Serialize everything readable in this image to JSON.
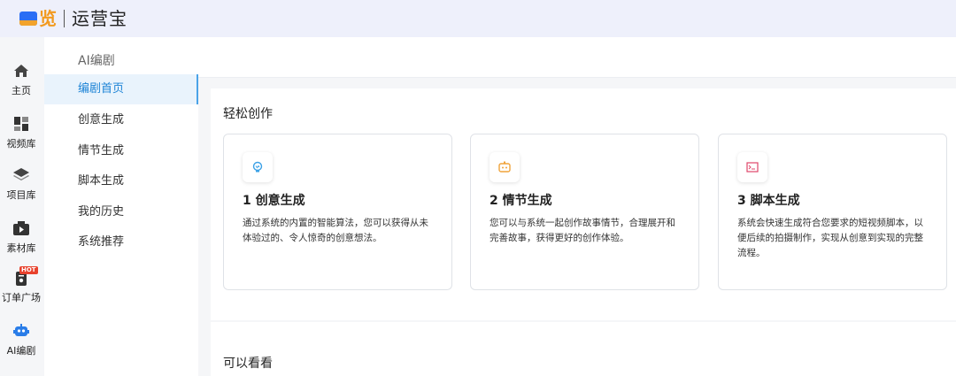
{
  "header": {
    "logo_char": "览",
    "app_name": "运营宝"
  },
  "rail": {
    "items": [
      {
        "label": "主页",
        "icon": "home-icon"
      },
      {
        "label": "视频库",
        "icon": "video-library-icon"
      },
      {
        "label": "项目库",
        "icon": "layers-icon"
      },
      {
        "label": "素材库",
        "icon": "media-icon"
      },
      {
        "label": "订单广场",
        "icon": "order-icon",
        "badge": "HOT"
      },
      {
        "label": "AI编剧",
        "icon": "robot-icon",
        "active": true
      }
    ]
  },
  "submenu": {
    "title": "AI编剧",
    "items": [
      {
        "label": "编剧首页",
        "active": true
      },
      {
        "label": "创意生成"
      },
      {
        "label": "情节生成"
      },
      {
        "label": "脚本生成"
      },
      {
        "label": "我的历史"
      },
      {
        "label": "系统推荐"
      }
    ]
  },
  "main": {
    "section_title": "轻松创作",
    "cards": [
      {
        "title": "1 创意生成",
        "desc": "通过系统的内置的智能算法，您可以获得从未体验过的、令人惊奇的创意想法。",
        "icon": "lightbulb-icon",
        "color": "#3aa0e6"
      },
      {
        "title": "2 情节生成",
        "desc": "您可以与系统一起创作故事情节，合理展开和完善故事，获得更好的创作体验。",
        "icon": "plot-icon",
        "color": "#f0a33a"
      },
      {
        "title": "3 脚本生成",
        "desc": "系统会快速生成符合您要求的短视频脚本，以便后续的拍摄制作，实现从创意到实现的完整流程。",
        "icon": "script-icon",
        "color": "#e0476a"
      }
    ],
    "section2_title": "可以看看"
  }
}
